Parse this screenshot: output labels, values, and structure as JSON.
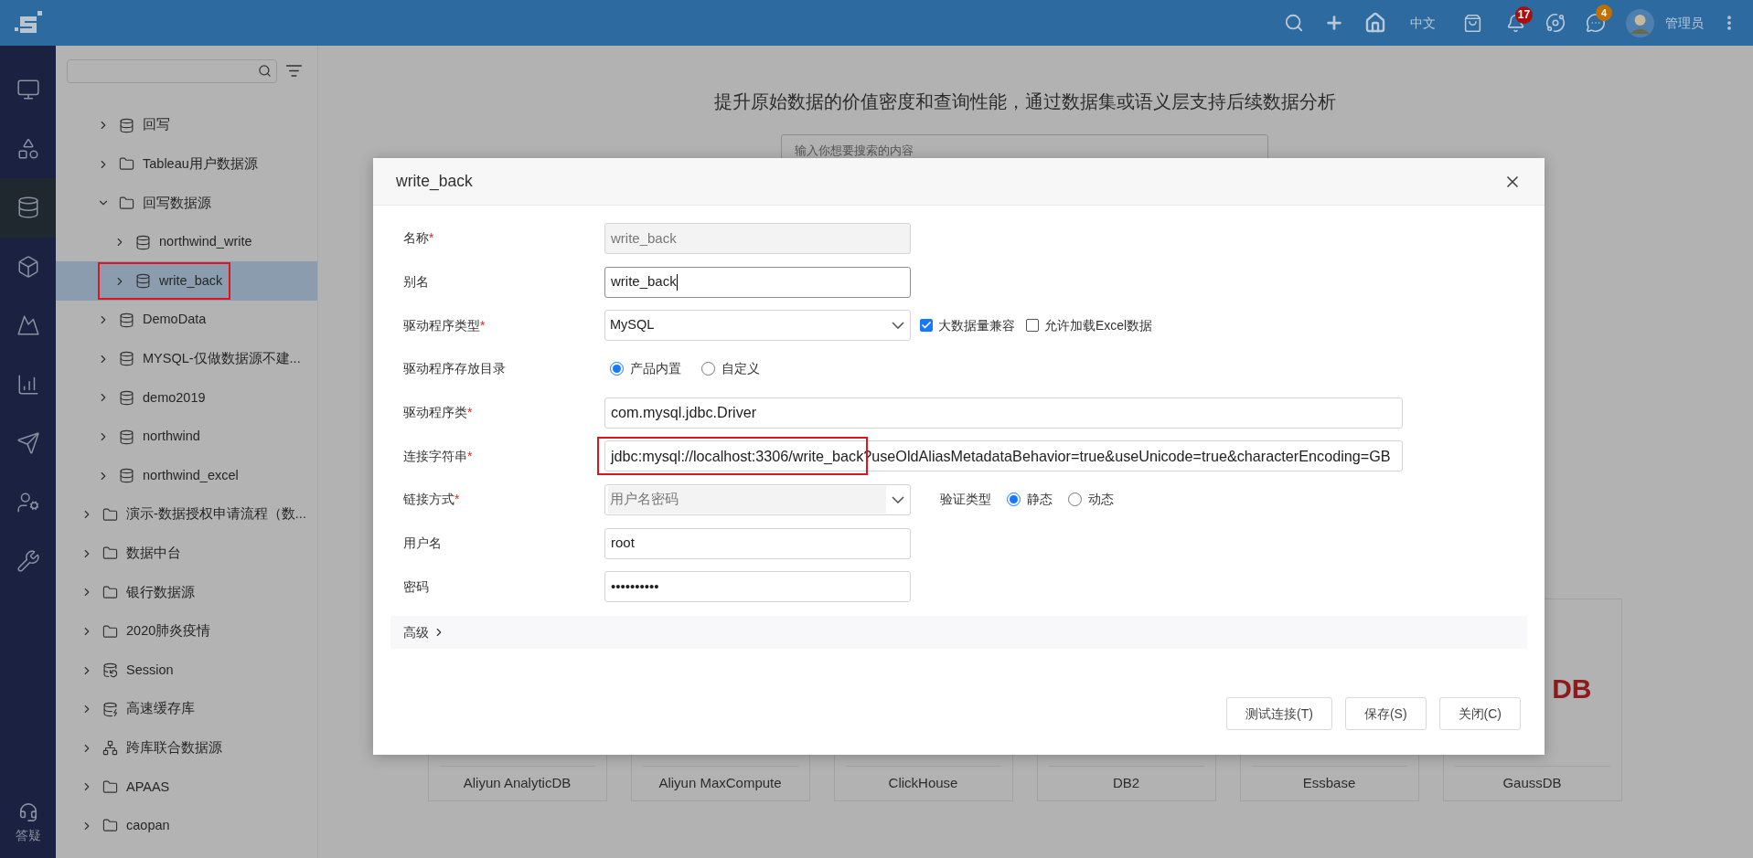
{
  "top_bar": {
    "language": "中文",
    "notifications_badge": "17",
    "messages_badge": "4",
    "user_name": "管理员"
  },
  "nav": {
    "items": [
      {
        "kind": "monitor",
        "selected": false
      },
      {
        "kind": "widgets",
        "selected": false
      },
      {
        "kind": "datasource",
        "selected": true
      },
      {
        "kind": "cube",
        "selected": false
      },
      {
        "kind": "slope",
        "selected": false
      },
      {
        "kind": "chart",
        "selected": false
      },
      {
        "kind": "send",
        "selected": false
      },
      {
        "kind": "user-gear",
        "selected": false
      },
      {
        "kind": "tools",
        "selected": false
      }
    ],
    "help_label": "答疑"
  },
  "sidebar": {
    "tree": [
      {
        "children": [
          {
            "label": "回写",
            "kind": "database",
            "expanded": false,
            "selected": false,
            "annotated": false
          },
          {
            "label": "Tableau用户数据源",
            "kind": "folder",
            "expanded": false,
            "selected": false,
            "annotated": false
          },
          {
            "label": "回写数据源",
            "kind": "folder",
            "expanded": true,
            "selected": false,
            "annotated": false,
            "children": [
              {
                "label": "northwind_write",
                "kind": "database",
                "expanded": false,
                "selected": false,
                "annotated": false
              },
              {
                "label": "write_back",
                "kind": "database",
                "expanded": false,
                "selected": true,
                "annotated": true
              }
            ]
          },
          {
            "label": "DemoData",
            "kind": "database",
            "expanded": false,
            "selected": false,
            "annotated": false
          },
          {
            "label": "MYSQL-仅做数据源不建...",
            "kind": "database",
            "expanded": false,
            "selected": false,
            "annotated": false
          },
          {
            "label": "demo2019",
            "kind": "database",
            "expanded": false,
            "selected": false,
            "annotated": false
          },
          {
            "label": "northwind",
            "kind": "database",
            "expanded": false,
            "selected": false,
            "annotated": false
          },
          {
            "label": "northwind_excel",
            "kind": "database",
            "expanded": false,
            "selected": false,
            "annotated": false
          }
        ]
      },
      {
        "label": "演示-数据授权申请流程（数...",
        "kind": "folder",
        "expanded": false,
        "selected": false,
        "annotated": false
      },
      {
        "label": "数据中台",
        "kind": "folder",
        "expanded": false,
        "selected": false,
        "annotated": false
      },
      {
        "label": "银行数据源",
        "kind": "folder",
        "expanded": false,
        "selected": false,
        "annotated": false
      },
      {
        "label": "2020肺炎疫情",
        "kind": "folder",
        "expanded": false,
        "selected": false,
        "annotated": false
      },
      {
        "label": "Session",
        "kind": "session",
        "expanded": false,
        "selected": false,
        "annotated": false
      },
      {
        "label": "高速缓存库",
        "kind": "cache",
        "expanded": false,
        "selected": false,
        "annotated": false
      },
      {
        "label": "跨库联合数据源",
        "kind": "federation",
        "expanded": false,
        "selected": false,
        "annotated": false
      },
      {
        "label": "APAAS",
        "kind": "folder",
        "expanded": false,
        "selected": false,
        "annotated": false
      },
      {
        "label": "caopan",
        "kind": "folder",
        "expanded": false,
        "selected": false,
        "annotated": false
      }
    ]
  },
  "main": {
    "headline": "提升原始数据的价值密度和查询性能，通过数据集或语义层支持后续数据分析",
    "search": {
      "placeholder": "输入你想要搜索的内容"
    },
    "cards": [
      {
        "name": "Aliyun AnalyticDB"
      },
      {
        "name": "Aliyun MaxCompute"
      },
      {
        "name": "ClickHouse"
      },
      {
        "name": "DB2"
      },
      {
        "name": "Essbase"
      },
      {
        "name": "GaussDB",
        "logo": [
          {
            "text": "DB",
            "color": "#8c1c1c"
          }
        ]
      }
    ]
  },
  "dialog": {
    "title": "write_back",
    "fields": [
      {
        "kind": "input",
        "label": "名称",
        "required_mark": "*",
        "value": "write_back",
        "disabled": true,
        "focused": false,
        "annotated": false
      },
      {
        "kind": "input",
        "label": "别名",
        "value": "write_back",
        "disabled": false,
        "focused": true,
        "annotated": false
      },
      {
        "kind": "select",
        "label": "驱动程序类型",
        "required_mark": "*",
        "value": "MySQL",
        "disabled": false,
        "checkboxes": [
          {
            "label": "大数据量兼容",
            "checked": true
          },
          {
            "label": "允许加载Excel数据",
            "checked": false
          }
        ]
      },
      {
        "kind": "radio",
        "label": "驱动程序存放目录",
        "options": [
          {
            "label": "产品内置",
            "selected": true
          },
          {
            "label": "自定义",
            "selected": false
          }
        ]
      },
      {
        "kind": "long_input",
        "label": "驱动程序类",
        "required_mark": "*",
        "value": "com.mysql.jdbc.Driver",
        "disabled": false,
        "focused": false,
        "annotated": false
      },
      {
        "kind": "long_input",
        "label": "连接字符串",
        "required_mark": "*",
        "value": "jdbc:mysql://localhost:3306/write_back?useOldAliasMetadataBehavior=true&useUnicode=true&characterEncoding=GB",
        "disabled": false,
        "focused": false,
        "annotated": true
      },
      {
        "kind": "select",
        "label": "链接方式",
        "required_mark": "*",
        "value": "用户名密码",
        "disabled": true,
        "extra": {
          "label": "验证类型",
          "options": [
            {
              "label": "静态",
              "selected": true
            },
            {
              "label": "动态",
              "selected": false
            }
          ]
        }
      },
      {
        "kind": "input",
        "label": "用户名",
        "value": "root",
        "disabled": false,
        "focused": false,
        "annotated": false
      },
      {
        "kind": "password",
        "label": "密码",
        "value": "••••••••••"
      }
    ],
    "advanced": {
      "label": "高级",
      "expanded": false
    },
    "buttons": [
      "测试连接(T)",
      "保存(S)",
      "关闭(C)"
    ]
  }
}
